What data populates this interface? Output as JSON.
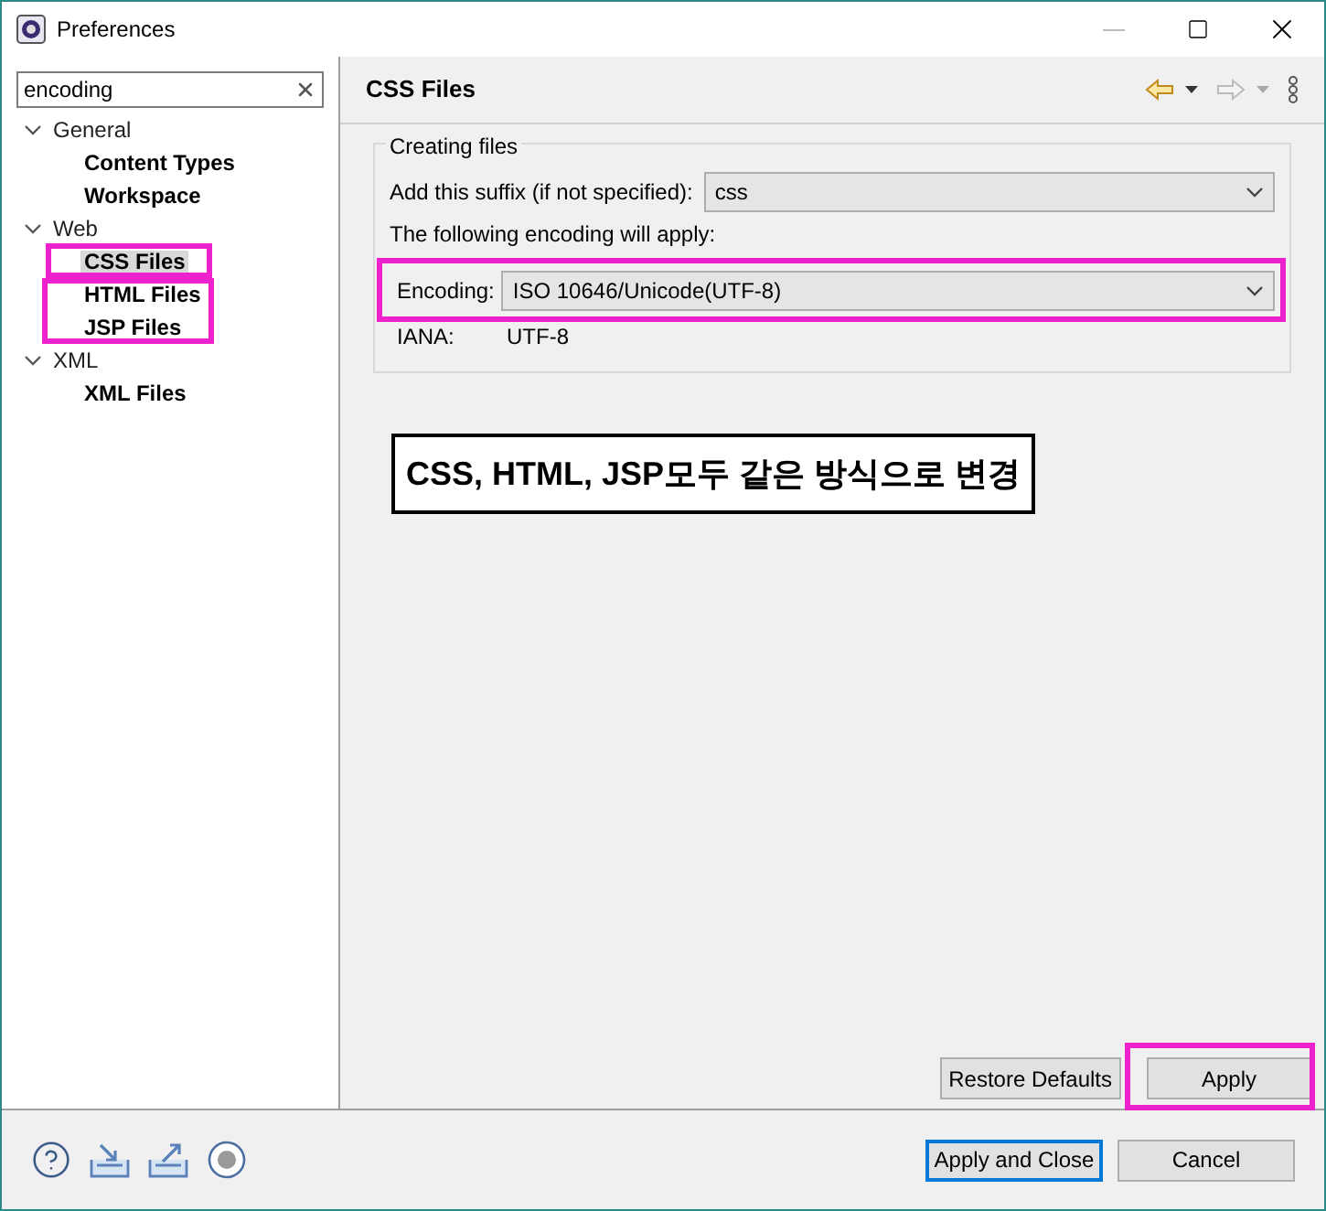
{
  "window": {
    "title": "Preferences"
  },
  "filter": {
    "value": "encoding"
  },
  "tree": [
    {
      "label": "General",
      "expanded": true,
      "selected": false,
      "children": [
        {
          "label": "Content Types",
          "selected": false
        },
        {
          "label": "Workspace",
          "selected": false
        }
      ]
    },
    {
      "label": "Web",
      "expanded": true,
      "selected": false,
      "children": [
        {
          "label": "CSS Files",
          "selected": true
        },
        {
          "label": "HTML Files",
          "selected": false
        },
        {
          "label": "JSP Files",
          "selected": false
        }
      ]
    },
    {
      "label": "XML",
      "expanded": true,
      "selected": false,
      "children": [
        {
          "label": "XML Files",
          "selected": false
        }
      ]
    }
  ],
  "page": {
    "title": "CSS Files"
  },
  "group": {
    "title": "Creating files",
    "suffix_label": "Add this suffix (if not specified):",
    "suffix_value": "css",
    "encoding_note": "The following encoding will apply:",
    "encoding_label": "Encoding:",
    "encoding_value": "ISO 10646/Unicode(UTF-8)",
    "iana_label": "IANA:",
    "iana_value": "UTF-8"
  },
  "callout": "CSS, HTML, JSP모두 같은 방식으로 변경",
  "page_buttons": [
    "Restore Defaults",
    "Apply"
  ],
  "dialog_buttons": [
    {
      "label": "Apply and Close",
      "default": true
    },
    {
      "label": "Cancel",
      "default": false
    }
  ]
}
